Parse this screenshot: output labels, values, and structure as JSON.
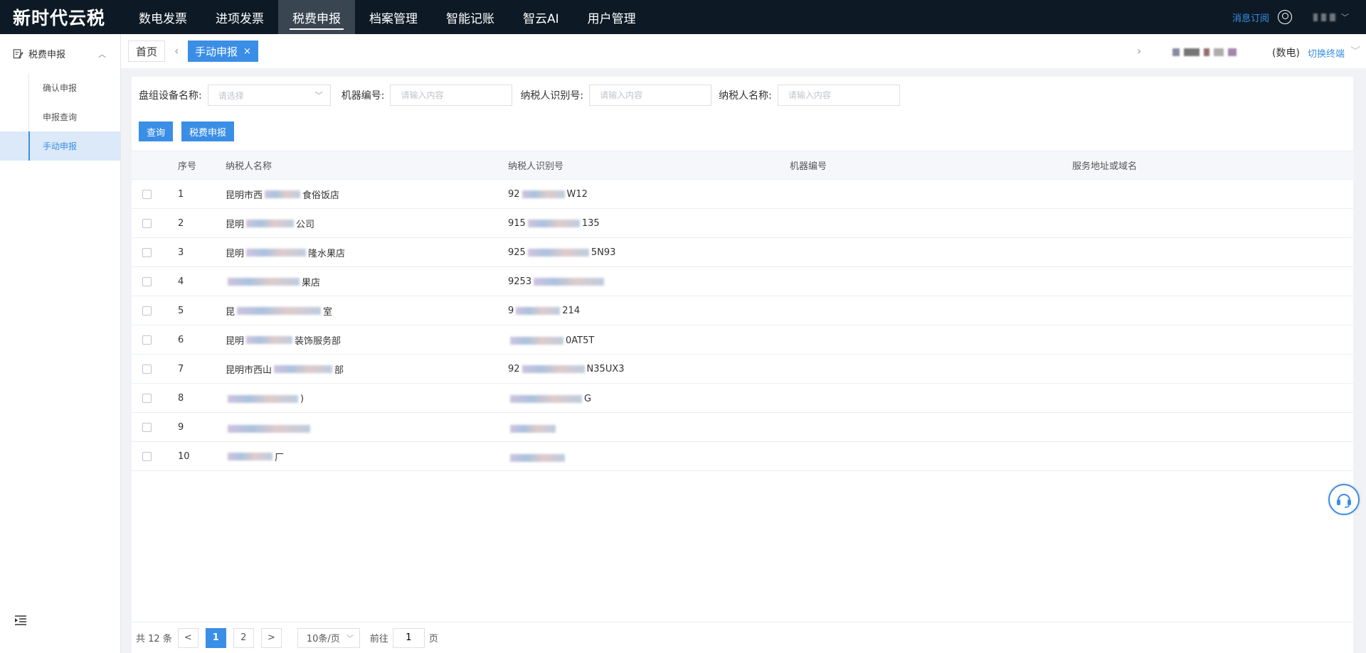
{
  "brand": "新时代云税",
  "nav": [
    {
      "label": "数电发票"
    },
    {
      "label": "进项发票"
    },
    {
      "label": "税费申报"
    },
    {
      "label": "档案管理"
    },
    {
      "label": "智能记账"
    },
    {
      "label": "智云AI"
    },
    {
      "label": "用户管理"
    }
  ],
  "active_nav": "税费申报",
  "header_right": {
    "message_link": "消息订阅"
  },
  "sidebar": {
    "group": "税费申报",
    "items": [
      {
        "label": "确认申报"
      },
      {
        "label": "申报查询"
      },
      {
        "label": "手动申报"
      }
    ],
    "active_item": "手动申报"
  },
  "tabs": {
    "home": "首页",
    "current": "手动申报",
    "close": "×",
    "org_type": "(数电)",
    "switch_terminal": "切换终端"
  },
  "filters": {
    "device_label": "盘组设备名称:",
    "device_placeholder": "请选择",
    "machine_label": "机器编号:",
    "machine_placeholder": "请输入内容",
    "taxid_label": "纳税人识别号:",
    "taxid_placeholder": "请输入内容",
    "taxname_label": "纳税人名称:",
    "taxname_placeholder": "请输入内容"
  },
  "buttons": {
    "query": "查询",
    "declare": "税费申报"
  },
  "table": {
    "headers": {
      "no": "序号",
      "name": "纳税人名称",
      "taxid": "纳税人识别号",
      "machine": "机器编号",
      "address": "服务地址或域名"
    },
    "rows": [
      {
        "no": "1",
        "name_pre": "昆明市西",
        "name_post": "食俗饭店",
        "id_pre": "92",
        "id_post": "W12"
      },
      {
        "no": "2",
        "name_pre": "昆明",
        "name_post": "公司",
        "id_pre": "915",
        "id_post": "135"
      },
      {
        "no": "3",
        "name_pre": "昆明",
        "name_post": "隆水果店",
        "id_pre": "925",
        "id_post": "5N93"
      },
      {
        "no": "4",
        "name_pre": "",
        "name_post": "果店",
        "id_pre": "9253",
        "id_post": ""
      },
      {
        "no": "5",
        "name_pre": "昆",
        "name_post": "室",
        "id_pre": "9",
        "id_post": "214"
      },
      {
        "no": "6",
        "name_pre": "昆明",
        "name_post": "装饰服务部",
        "id_pre": "",
        "id_post": "0AT5T"
      },
      {
        "no": "7",
        "name_pre": "昆明市西山",
        "name_post": "部",
        "id_pre": "92",
        "id_post": "N35UX3"
      },
      {
        "no": "8",
        "name_pre": "",
        "name_post": ")",
        "id_pre": "",
        "id_post": "G"
      },
      {
        "no": "9",
        "name_pre": "",
        "name_post": "",
        "id_pre": "",
        "id_post": ""
      },
      {
        "no": "10",
        "name_pre": "",
        "name_post": "厂",
        "id_pre": "",
        "id_post": ""
      }
    ]
  },
  "pagination": {
    "total": "共 12 条",
    "prev": "<",
    "pages": [
      "1",
      "2"
    ],
    "next": ">",
    "page_size": "10条/页",
    "goto_label": "前往",
    "goto_value": "1",
    "page_unit": "页"
  },
  "colors": {
    "topbar": "#0d1a26",
    "accent": "#3a8ee6",
    "active_nav_bg": "#3a4552"
  }
}
